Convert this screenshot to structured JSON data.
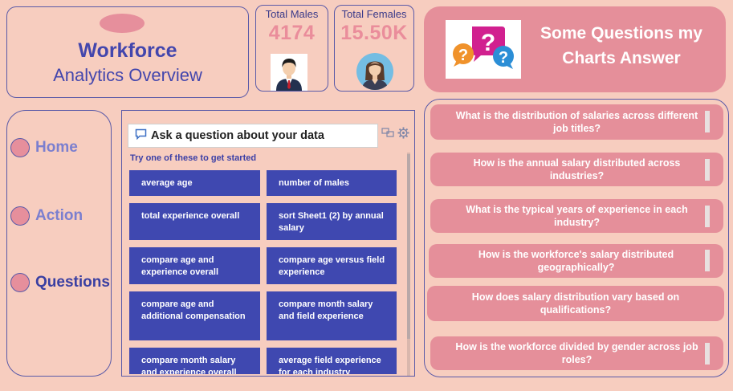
{
  "title": {
    "main": "Workforce",
    "sub": "Analytics Overview"
  },
  "kpis": {
    "males": {
      "label": "Total Males",
      "value": "4174",
      "icon": "male-avatar-icon"
    },
    "females": {
      "label": "Total Females",
      "value": "15.50K",
      "icon": "female-avatar-icon"
    }
  },
  "header": {
    "title_line1": "Some Questions my",
    "title_line2": "Charts Answer",
    "icon": "question-bubbles-icon"
  },
  "nav": {
    "items": [
      {
        "label": "Home"
      },
      {
        "label": "Action"
      },
      {
        "label": "Questions"
      }
    ]
  },
  "qa": {
    "input_placeholder": "Ask a question about your data",
    "hint": "Try one of these to get started",
    "suggestions": [
      "average age",
      "number of males",
      "total experience overall",
      "sort Sheet1 (2) by annual salary",
      "compare age and experience overall",
      "compare age versus field experience",
      "compare age and additional compensation",
      "compare month salary and field experience",
      "compare month salary and experience overall",
      "average field experience for each industry"
    ]
  },
  "questions": [
    "What is the distribution of salaries across different job titles?",
    "How is the annual salary distributed across industries?",
    "What is the typical years of experience in each industry?",
    "How is the workforce's salary distributed geographically?",
    "How does salary distribution vary based on qualifications?",
    "How is  the workforce divided by gender across job roles?"
  ],
  "colors": {
    "background": "#f7cdbf",
    "accent": "#e58f9a",
    "primary": "#4346ad",
    "button": "#3f48b0"
  }
}
